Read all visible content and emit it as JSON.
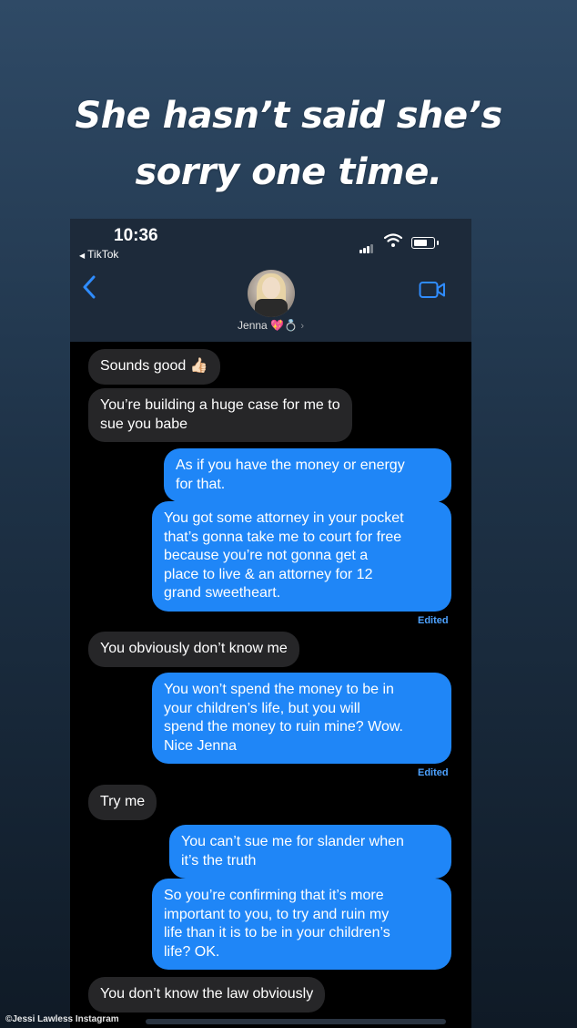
{
  "headline": {
    "line1": "She hasn’t said she’s",
    "line2": "sorry one time."
  },
  "status_bar": {
    "time": "10:36",
    "back_app": "TikTok"
  },
  "contact": {
    "name": "Jenna",
    "heart_emoji": "💖",
    "ring_emoji": "💍",
    "chevron": "›"
  },
  "messages": [
    {
      "side": "in",
      "text": "Sounds good 👍🏻"
    },
    {
      "side": "in",
      "text": "You’re building a huge case for me to\nsue you babe"
    },
    {
      "side": "out",
      "text": "As if you have the money or energy\nfor that."
    },
    {
      "side": "out",
      "text": "You got some attorney in your pocket\nthat’s gonna take me to court for free\nbecause you’re not gonna get a\nplace to live & an attorney for 12\ngrand sweetheart.",
      "edited": "Edited"
    },
    {
      "side": "in",
      "text": "You obviously don’t know me"
    },
    {
      "side": "out",
      "text": "You won’t spend the money to be in\nyour children’s life, but you will\nspend the money to ruin mine? Wow.\nNice Jenna",
      "edited": "Edited"
    },
    {
      "side": "in",
      "text": "Try me"
    },
    {
      "side": "out",
      "text": "You can’t sue me for slander when\nit’s the truth"
    },
    {
      "side": "out",
      "text": "So you’re confirming that it’s more\nimportant to you, to try and ruin my\nlife than it is to be in your children’s\nlife? OK."
    },
    {
      "side": "in",
      "text": "You don’t know the law obviously"
    }
  ],
  "watermark": "©Jessi Lawless Instagram",
  "colors": {
    "outgoing_bubble": "#1f86f7",
    "incoming_bubble": "#262628",
    "edited_label": "#4da2ff"
  }
}
